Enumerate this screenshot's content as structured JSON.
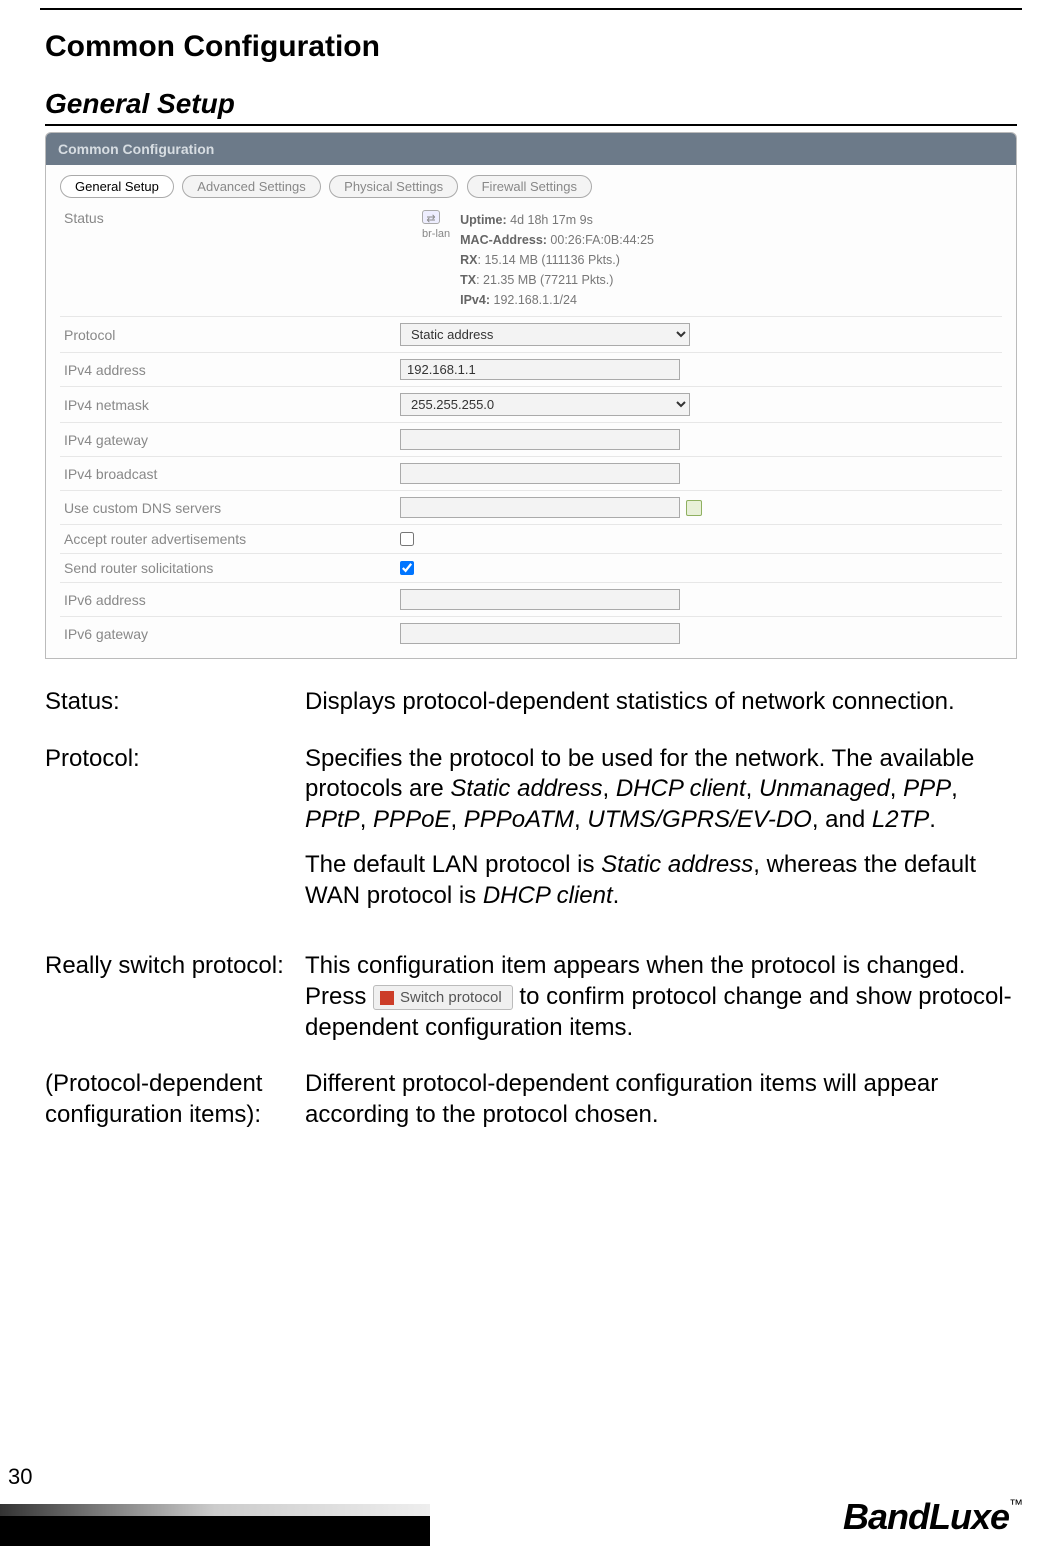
{
  "page": {
    "title": "Common Configuration",
    "section": "General Setup",
    "number": "30",
    "brand": "BandLuxe",
    "brand_tm": "™"
  },
  "panel": {
    "header": "Common Configuration",
    "tabs": {
      "active": "General Setup",
      "t2": "Advanced Settings",
      "t3": "Physical Settings",
      "t4": "Firewall Settings"
    },
    "status": {
      "label": "Status",
      "iface_icon_hint": "br-lan",
      "uptime_k": "Uptime:",
      "uptime_v": "4d 18h 17m 9s",
      "mac_k": "MAC-Address:",
      "mac_v": "00:26:FA:0B:44:25",
      "rx_k": "RX",
      "rx_v": ": 15.14 MB (111136 Pkts.)",
      "tx_k": "TX",
      "tx_v": ": 21.35 MB (77211 Pkts.)",
      "ipv4_k": "IPv4:",
      "ipv4_v": "192.168.1.1/24"
    },
    "fields": {
      "protocol": {
        "label": "Protocol",
        "value": "Static address"
      },
      "ipv4_addr": {
        "label": "IPv4 address",
        "value": "192.168.1.1"
      },
      "ipv4_mask": {
        "label": "IPv4 netmask",
        "value": "255.255.255.0"
      },
      "ipv4_gw": {
        "label": "IPv4 gateway",
        "value": ""
      },
      "ipv4_bc": {
        "label": "IPv4 broadcast",
        "value": ""
      },
      "dns": {
        "label": "Use custom DNS servers",
        "value": ""
      },
      "accept_ra": {
        "label": "Accept router advertisements"
      },
      "send_rs": {
        "label": "Send router solicitations"
      },
      "ipv6_addr": {
        "label": "IPv6 address",
        "value": ""
      },
      "ipv6_gw": {
        "label": "IPv6 gateway",
        "value": ""
      }
    }
  },
  "descriptions": {
    "status": {
      "term": "Status:",
      "def": "Displays protocol-dependent statistics of network connection."
    },
    "protocol": {
      "term": "Protocol:",
      "def1a": "Specifies the protocol to be used for the network. The available protocols are ",
      "em1": "Static address",
      "c1": ", ",
      "em2": "DHCP client",
      "c2": ", ",
      "em3": "Unmanaged",
      "c3": ", ",
      "em4": "PPP",
      "c4": ", ",
      "em5": "PPtP",
      "c5": ", ",
      "em6": "PPPoE",
      "c6": ", ",
      "em7": "PPPoATM",
      "c7": ", ",
      "em8": "UTMS/GPRS/EV-DO",
      "c8": ", and ",
      "em9": "L2TP",
      "c9": ".",
      "def2a": "The default LAN protocol is ",
      "em10": "Static address",
      "def2b": ", whereas the default WAN protocol is ",
      "em11": "DHCP client",
      "def2c": "."
    },
    "switch": {
      "term": "Really switch protocol:",
      "def_a": "This configuration item appears when the protocol is changed. Press ",
      "btn": "Switch protocol",
      "def_b": " to confirm protocol change and show protocol-dependent configuration items."
    },
    "pdep": {
      "term": "(Protocol-dependent configuration items):",
      "def": "Different protocol-dependent configuration items will appear according to the protocol chosen."
    }
  }
}
